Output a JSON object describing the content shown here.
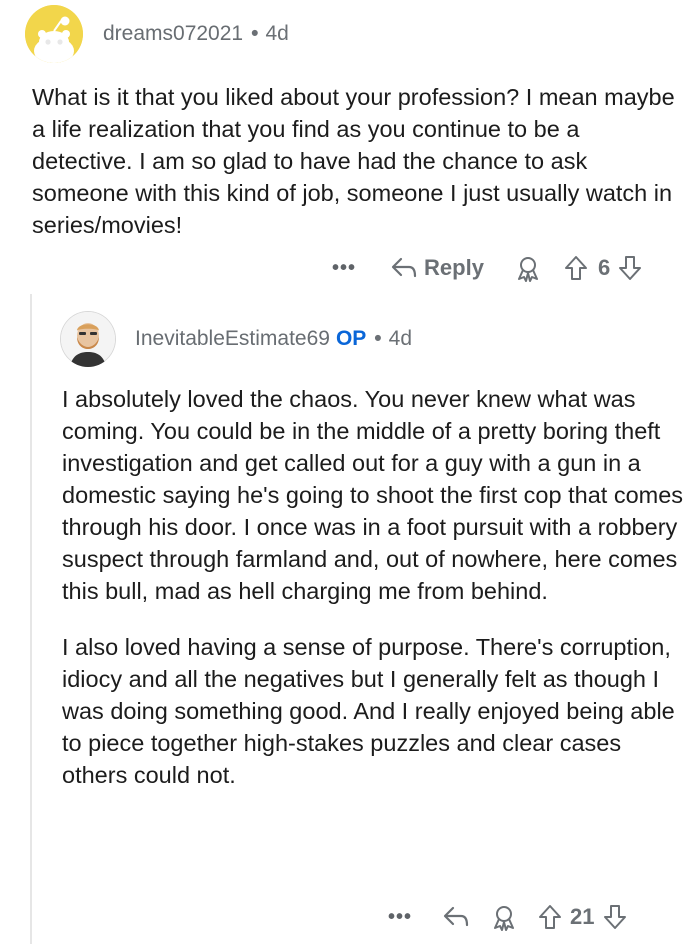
{
  "parent_comment": {
    "username": "dreams072021",
    "separator": "•",
    "age": "4d",
    "body": "What is it that you liked about your profession? I mean maybe a life realization that you find as you continue to be a detective. I am so glad to have had the chance to ask someone with this kind of job, someone I just usually watch in series/movies!",
    "actions": {
      "more_label": "•••",
      "reply_label": "Reply",
      "vote_count": "6"
    }
  },
  "reply_comment": {
    "username": "InevitableEstimate69",
    "op_badge": "OP",
    "separator": "•",
    "age": "4d",
    "paragraphs": [
      "I absolutely loved the chaos. You never knew what was coming. You could be in the middle of a pretty boring theft investigation and get called out for a guy with a gun in a domestic saying he's going to shoot the first cop that comes through his door. I once was in a foot pursuit with a robbery suspect through farmland and, out of nowhere, here comes this bull, mad as hell charging me from behind.",
      "I also loved having a sense of purpose. There's corruption, idiocy and all the negatives but I generally felt as though I was doing something good. And I really enjoyed being able to piece together high-stakes puzzles and clear cases others could not."
    ],
    "actions": {
      "more_label": "•••",
      "vote_count": "21"
    }
  },
  "icons": {
    "parent_avatar": "snoo-avatar-icon",
    "child_avatar": "bearded-man-avatar-icon",
    "reply": "reply-arrow-icon",
    "award": "award-icon",
    "upvote": "upvote-arrow-icon",
    "downvote": "downvote-arrow-icon"
  },
  "colors": {
    "op_badge": "#0a66d8",
    "meta_text": "#6b7075",
    "parent_avatar_bg": "#f2d64b"
  }
}
